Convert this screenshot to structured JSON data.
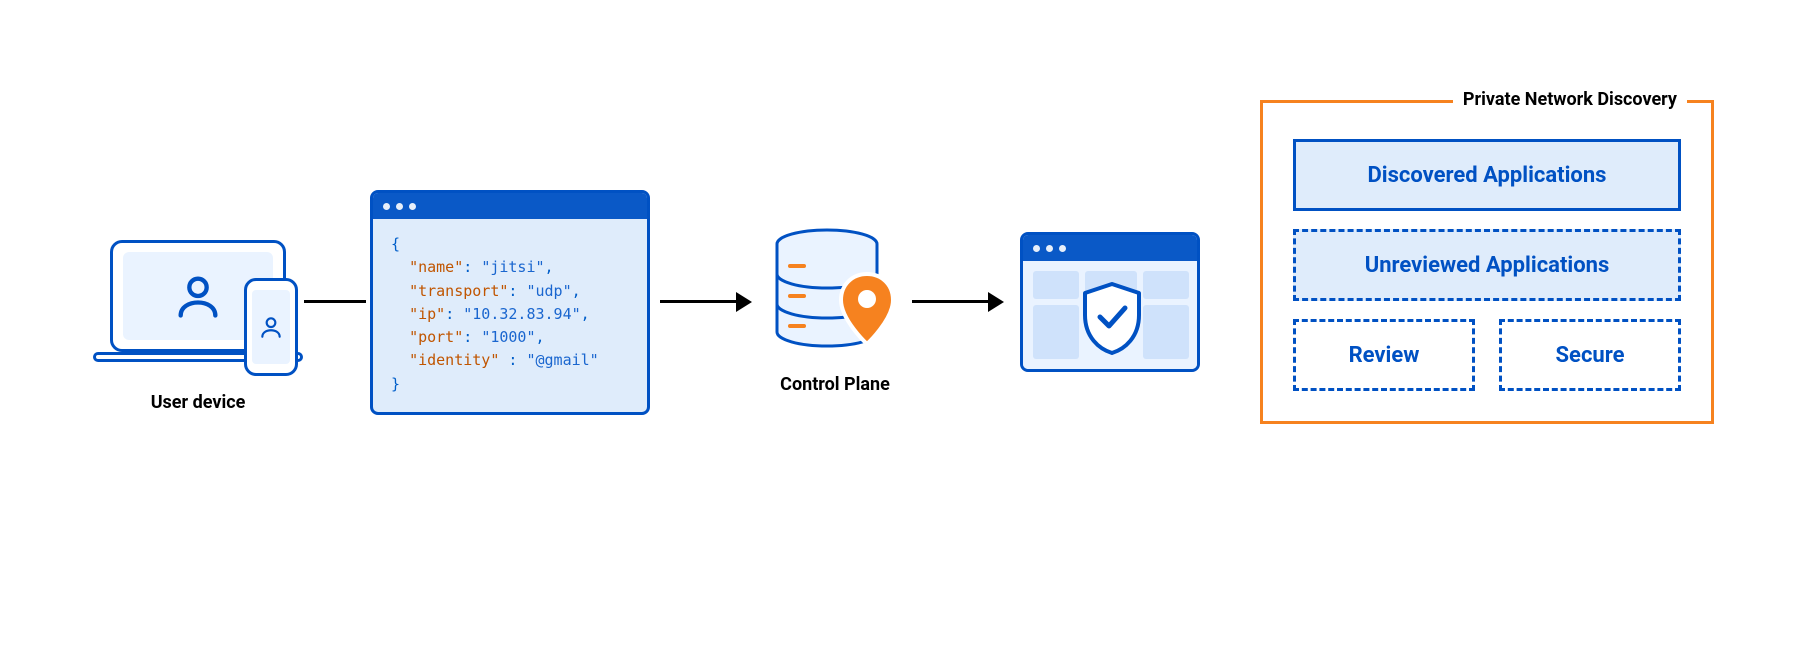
{
  "user_device": {
    "label": "User device"
  },
  "code": {
    "pairs": [
      {
        "key": "name",
        "value": "jitsi"
      },
      {
        "key": "transport",
        "value": "udp"
      },
      {
        "key": "ip",
        "value": "10.32.83.94"
      },
      {
        "key": "port",
        "value": "1000"
      },
      {
        "key": "identity",
        "value": "@gmail"
      }
    ]
  },
  "control_plane": {
    "label": "Control Plane"
  },
  "panel": {
    "title": "Private Network Discovery",
    "discovered": "Discovered Applications",
    "unreviewed": "Unreviewed Applications",
    "review": "Review",
    "secure": "Secure"
  },
  "colors": {
    "blue_stroke": "#0051c3",
    "blue_fill": "#dfecfb",
    "orange_stroke": "#f6821f"
  }
}
